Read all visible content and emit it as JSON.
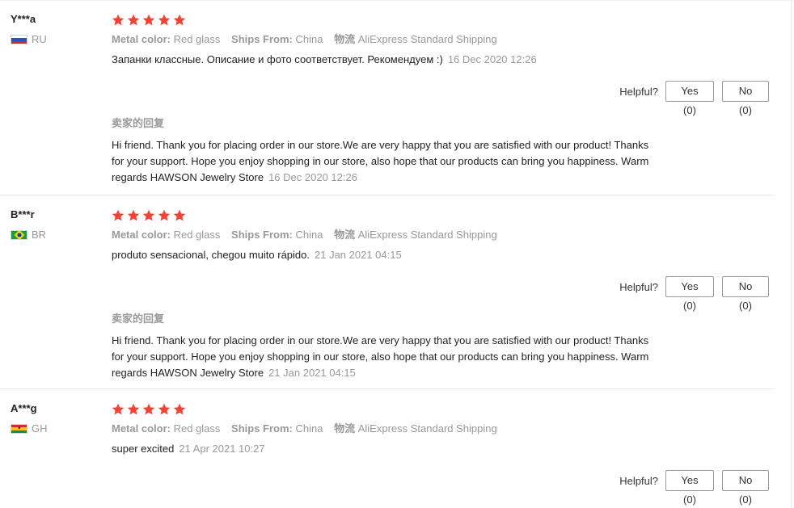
{
  "labels": {
    "metal_color": "Metal color:",
    "ships_from": "Ships From:",
    "logistics": "物流",
    "helpful": "Helpful?",
    "seller_reply": "卖家的回复"
  },
  "colors": {
    "star": "#f44336",
    "muted_text": "#999999",
    "body_text": "#222222",
    "button_border": "#999999"
  },
  "icons": [
    "star-icon",
    "flag-ru-icon",
    "flag-br-icon",
    "flag-gh-icon"
  ],
  "reviews": [
    {
      "user": "Y***a",
      "country": "RU",
      "rating": 5,
      "metal_color": "Red glass",
      "ships_from": "China",
      "logistics": "AliExpress Standard Shipping",
      "text": "Запанки классные. Описание и фото соответствует. Рекомендуем :)",
      "time": "16 Dec 2020 12:26",
      "yes": "Yes (0)",
      "no": "No (0)",
      "reply_text": "Hi friend. Thank you for placing order in our store.We are very happy that you are satisfied with our product! Thanks for your support. Hope you enjoy shopping in our store, also hope that our products can bring you happiness. Warm regards HAWSON Jewelry Store",
      "reply_time": "16 Dec 2020 12:26"
    },
    {
      "user": "B***r",
      "country": "BR",
      "rating": 5,
      "metal_color": "Red glass",
      "ships_from": "China",
      "logistics": "AliExpress Standard Shipping",
      "text": "produto sensacional, chegou muito rápido.",
      "time": "21 Jan 2021 04:15",
      "yes": "Yes (0)",
      "no": "No (0)",
      "reply_text": "Hi friend. Thank you for placing order in our store.We are very happy that you are satisfied with our product! Thanks for your support. Hope you enjoy shopping in our store, also hope that our products can bring you happiness. Warm regards HAWSON Jewelry Store",
      "reply_time": "21 Jan 2021 04:15"
    },
    {
      "user": "A***g",
      "country": "GH",
      "rating": 5,
      "metal_color": "Red glass",
      "ships_from": "China",
      "logistics": "AliExpress Standard Shipping",
      "text": "super excited",
      "time": "21 Apr 2021 10:27",
      "yes": "Yes (0)",
      "no": "No (0)"
    }
  ]
}
